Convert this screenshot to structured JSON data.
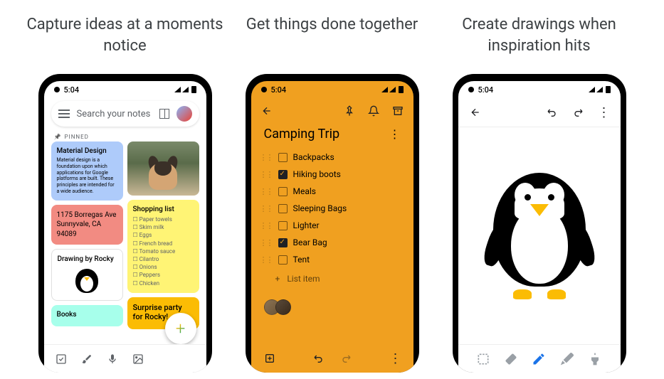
{
  "headlines": {
    "capture": "Capture ideas at a moments notice",
    "collab": "Get things done together",
    "draw": "Create drawings when inspiration hits"
  },
  "status": {
    "time": "5:04"
  },
  "screen1": {
    "search_placeholder": "Search your notes",
    "pinned_label": "PINNED",
    "notes": {
      "material": {
        "title": "Material Design",
        "body": "Material design is a foundation upon which applications for Google platforms are built. These principles are intended for a wide audience."
      },
      "address": {
        "body": "1175 Borregas Ave Sunnyvale, CA 94089"
      },
      "drawing": {
        "title": "Drawing by Rocky"
      },
      "books": {
        "title": "Books"
      },
      "shopping": {
        "title": "Shopping list",
        "items": [
          "Paper towels",
          "Skim milk",
          "Eggs",
          "French bread",
          "Tomato sauce",
          "Cilantro",
          "Onions",
          "Peppers",
          "Chicken"
        ]
      },
      "party": {
        "title": "Surprise party for Rocky!"
      }
    }
  },
  "screen2": {
    "title": "Camping Trip",
    "items": [
      {
        "label": "Backpacks",
        "checked": false
      },
      {
        "label": "Hiking boots",
        "checked": true
      },
      {
        "label": "Meals",
        "checked": false
      },
      {
        "label": "Sleeping Bags",
        "checked": false
      },
      {
        "label": "Lighter",
        "checked": false
      },
      {
        "label": "Bear Bag",
        "checked": true
      },
      {
        "label": "Tent",
        "checked": false
      }
    ],
    "add_label": "List item"
  },
  "colors": {
    "yellow": "#f0a020",
    "accent": "#fbbc04"
  }
}
